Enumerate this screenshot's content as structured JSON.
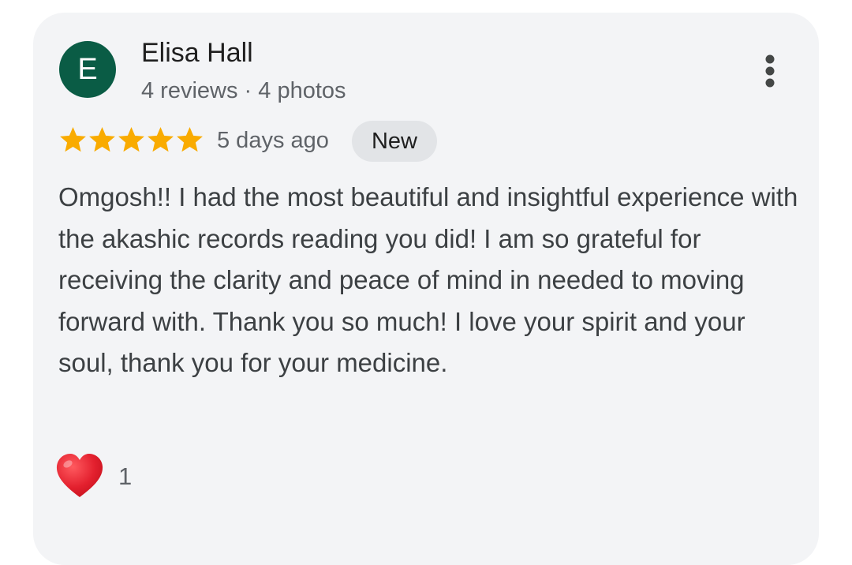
{
  "review": {
    "author": {
      "initial": "E",
      "name": "Elisa Hall",
      "meta": "4 reviews · 4 photos",
      "avatar_color": "#0a5c45"
    },
    "rating": 5,
    "max_rating": 5,
    "date": "5 days ago",
    "badge": "New",
    "text": "Omgosh!! I had the most beautiful and insightful experience with the akashic records reading you did! I am so grateful for receiving the clarity and peace of mind in needed to moving forward with. Thank you so much! I love your spirit and your soul, thank you for your medicine.",
    "reaction": {
      "icon": "heart-emoji-icon",
      "count": "1"
    },
    "more_icon": "more-vertical-icon"
  },
  "colors": {
    "star": "#f9ab00",
    "card_bg": "#f3f4f6",
    "badge_bg": "#e2e4e7",
    "heart": "#e3202e"
  }
}
